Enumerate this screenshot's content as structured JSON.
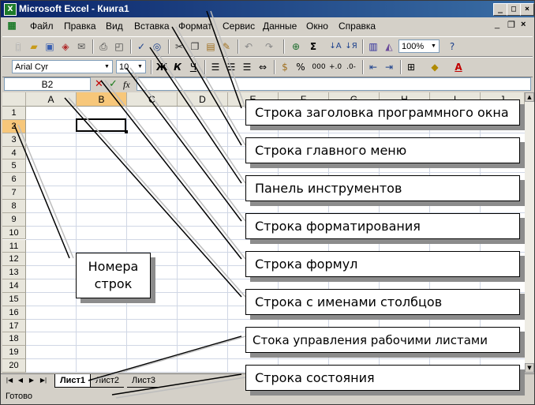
{
  "window": {
    "title": "Microsoft Excel - Книга1",
    "app_icon": "excel-icon"
  },
  "menu": [
    {
      "key": "file",
      "label": "Файл"
    },
    {
      "key": "edit",
      "label": "Правка"
    },
    {
      "key": "view",
      "label": "Вид"
    },
    {
      "key": "insert",
      "label": "Вставка"
    },
    {
      "key": "format",
      "label": "Формат"
    },
    {
      "key": "service",
      "label": "Сервис"
    },
    {
      "key": "data",
      "label": "Данные"
    },
    {
      "key": "window",
      "label": "Окно"
    },
    {
      "key": "help",
      "label": "Справка"
    }
  ],
  "toolbar": {
    "zoom": "100%"
  },
  "formatting": {
    "font": "Arial Cyr",
    "size": "10",
    "bold": "Ж",
    "italic": "К",
    "underline": "Ч",
    "font_color_label": "A",
    "thousands": "000"
  },
  "formula_bar": {
    "name_box": "B2",
    "fx": "fx",
    "cancel": "✕",
    "enter": "✓"
  },
  "grid": {
    "columns": [
      "A",
      "B",
      "C",
      "D",
      "E",
      "F",
      "G",
      "H",
      "I",
      "J"
    ],
    "rows": [
      "1",
      "2",
      "3",
      "4",
      "5",
      "6",
      "7",
      "8",
      "9",
      "10",
      "11",
      "12",
      "13",
      "14",
      "15",
      "16",
      "17",
      "18",
      "19",
      "20"
    ],
    "active_cell": "B2"
  },
  "sheets": {
    "tabs": [
      "Лист1",
      "Лист2",
      "Лист3"
    ],
    "active": "Лист1"
  },
  "status": {
    "text": "Готово"
  },
  "annotations": {
    "title_bar": "Строка заголовка программного окна",
    "main_menu": "Строка главного меню",
    "toolbar": "Панель инструментов",
    "formatting": "Строка форматирования",
    "formula": "Строка формул",
    "column_names": "Строка  с именами столбцов",
    "sheet_control": "Стока управления рабочими листами",
    "status": "Строка состояния",
    "row_numbers_line1": "Номера",
    "row_numbers_line2": "строк"
  },
  "colors": {
    "title_gradient_start": "#0a246a",
    "title_gradient_end": "#3a6ea5",
    "selection": "#000000"
  }
}
